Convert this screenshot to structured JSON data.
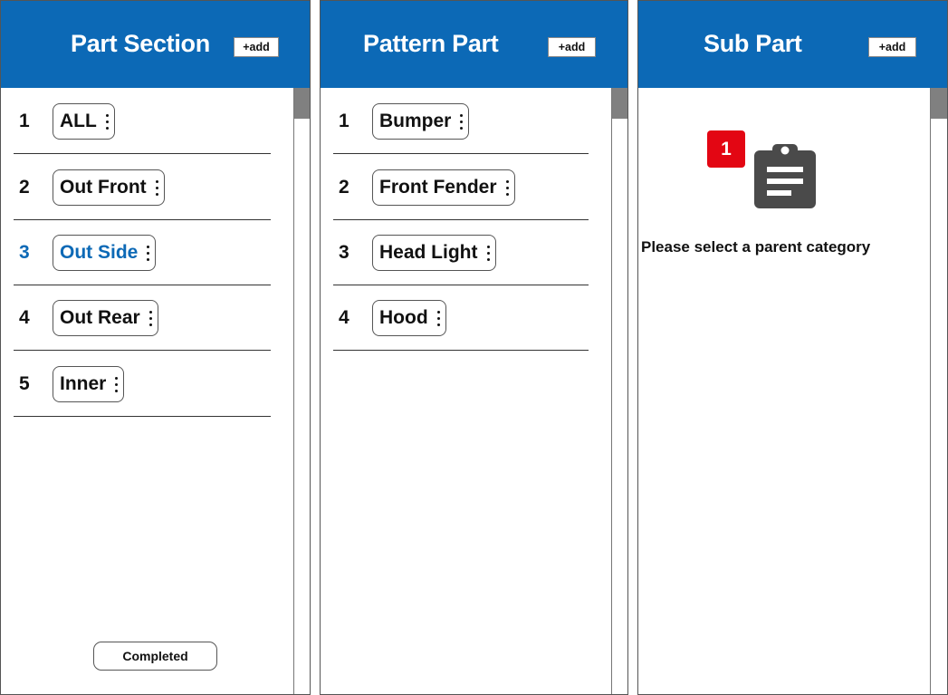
{
  "panels": {
    "part_section": {
      "title": "Part Section",
      "add_label": "+add",
      "items": [
        {
          "num": "1",
          "label": "ALL"
        },
        {
          "num": "2",
          "label": "Out Front"
        },
        {
          "num": "3",
          "label": "Out Side"
        },
        {
          "num": "4",
          "label": "Out Rear"
        },
        {
          "num": "5",
          "label": "Inner"
        }
      ],
      "selected_index": 2,
      "completed_label": "Completed"
    },
    "pattern_part": {
      "title": "Pattern Part",
      "add_label": "+add",
      "items": [
        {
          "num": "1",
          "label": "Bumper"
        },
        {
          "num": "2",
          "label": "Front Fender"
        },
        {
          "num": "3",
          "label": "Head Light"
        },
        {
          "num": "4",
          "label": "Hood"
        }
      ]
    },
    "sub_part": {
      "title": "Sub Part",
      "add_label": "+add",
      "badge": "1",
      "empty_icon": "clipboard-icon",
      "empty_message": "Please select a parent category"
    }
  },
  "colors": {
    "header_bg": "#0c69b6",
    "selected_text": "#0c69b6",
    "badge_bg": "#e30613",
    "scroll_thumb": "#808080",
    "icon": "#4a4a4a"
  }
}
